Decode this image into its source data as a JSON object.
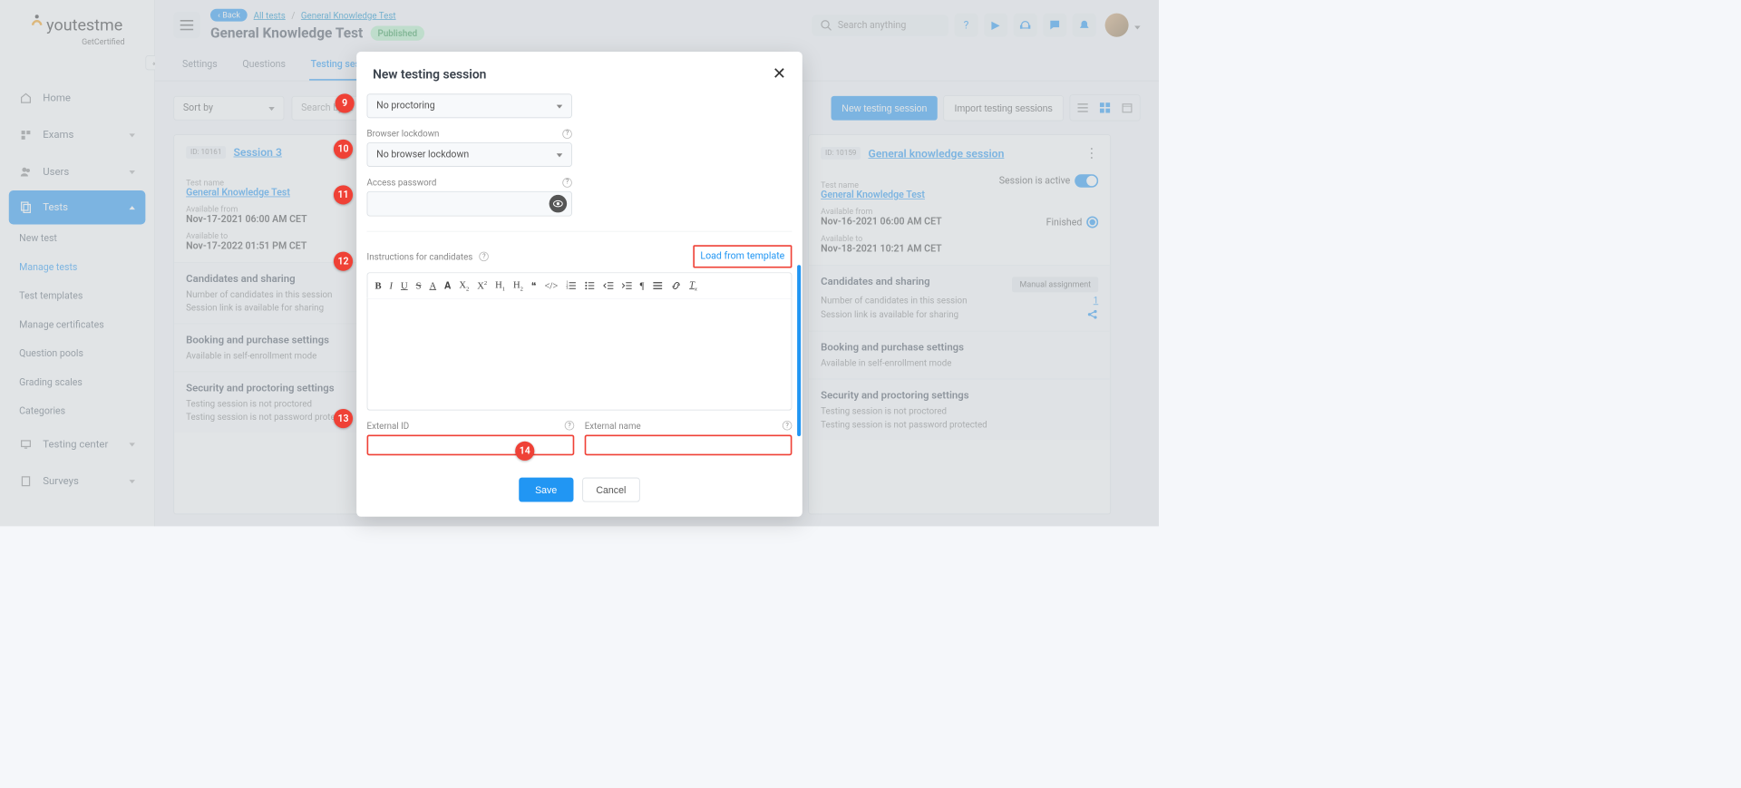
{
  "logo": {
    "text": "youtestme",
    "sub": "GetCertified"
  },
  "nav": {
    "home": "Home",
    "exams": "Exams",
    "users": "Users",
    "tests": "Tests",
    "testing_center": "Testing center",
    "surveys": "Surveys"
  },
  "tests_submenu": {
    "new_test": "New test",
    "manage_tests": "Manage tests",
    "test_templates": "Test templates",
    "manage_certificates": "Manage certificates",
    "question_pools": "Question pools",
    "grading_scales": "Grading scales",
    "categories": "Categories"
  },
  "topbar": {
    "back": "Back",
    "crumb_all": "All tests",
    "crumb_test": "General Knowledge Test",
    "title": "General Knowledge Test",
    "published": "Published",
    "search_placeholder": "Search anything"
  },
  "tabs": {
    "settings": "Settings",
    "questions": "Questions",
    "sessions": "Testing ses"
  },
  "filter": {
    "sort": "Sort by",
    "search_placeholder": "Search by te",
    "new_session": "New testing session",
    "import": "Import testing sessions"
  },
  "card1": {
    "id": "ID: 10161",
    "name": "Session 3",
    "test_label": "Test name",
    "test_name": "General Knowledge Test",
    "from_label": "Available from",
    "from_val": "Nov-17-2021 06:00 AM CET",
    "to_label": "Available to",
    "to_val": "Nov-17-2022 01:51 PM CET",
    "cs1_title": "Candidates and sharing",
    "cs1_l1": "Number of candidates in this session",
    "cs1_l2": "Session link is available for sharing",
    "cs2_title": "Booking and purchase settings",
    "cs2_l1": "Available in self-enrollment mode",
    "cs3_title": "Security and proctoring settings",
    "cs3_l1": "Testing session is not proctored",
    "cs3_l2": "Testing session is not password protected"
  },
  "card3": {
    "id": "ID: 10159",
    "name": "General knowledge session",
    "test_label": "Test name",
    "test_name": "General Knowledge Test",
    "from_label": "Available from",
    "from_val": "Nov-16-2021 06:00 AM CET",
    "to_label": "Available to",
    "to_val": "Nov-18-2021 10:21 AM CET",
    "active": "Session is active",
    "finished": "Finished",
    "manual": "Manual assignment",
    "count": "1",
    "cs1_title": "Candidates and sharing",
    "cs1_l1": "Number of candidates in this session",
    "cs1_l2": "Session link is available for sharing",
    "cs2_title": "Booking and purchase settings",
    "cs2_l1": "Available in self-enrollment mode",
    "cs3_title": "Security and proctoring settings",
    "cs3_l1": "Testing session is not proctored",
    "cs3_l2": "Testing session is not password protected"
  },
  "modal": {
    "title": "New testing session",
    "proctoring_val": "No proctoring",
    "lockdown_label": "Browser lockdown",
    "lockdown_val": "No browser lockdown",
    "password_label": "Access password",
    "instructions_label": "Instructions for candidates",
    "load_template": "Load from template",
    "ext_id_label": "External ID",
    "ext_name_label": "External name",
    "save": "Save",
    "cancel": "Cancel"
  },
  "callouts": {
    "c9": "9",
    "c10": "10",
    "c11": "11",
    "c12": "12",
    "c13": "13",
    "c14": "14"
  }
}
